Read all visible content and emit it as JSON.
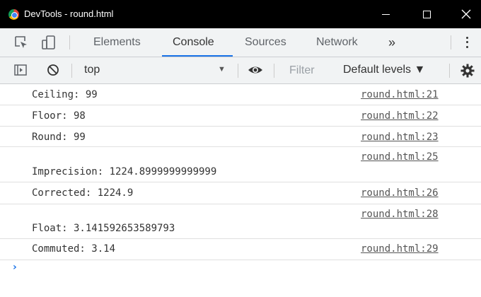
{
  "window": {
    "title": "DevTools - round.html",
    "icon": "chrome-icon"
  },
  "tabs": [
    {
      "label": "Elements",
      "active": false
    },
    {
      "label": "Console",
      "active": true
    },
    {
      "label": "Sources",
      "active": false
    },
    {
      "label": "Network",
      "active": false
    }
  ],
  "tabs_overflow": "»",
  "console_toolbar": {
    "context": "top",
    "filter_placeholder": "Filter",
    "levels": "Default levels ▼"
  },
  "messages": [
    {
      "text": "Ceiling: 99",
      "source": "round.html:21"
    },
    {
      "text": "Floor: 98",
      "source": "round.html:22"
    },
    {
      "text": "Round: 99",
      "source": "round.html:23"
    },
    {
      "text": "Imprecision: 1224.8999999999999",
      "source": "round.html:25"
    },
    {
      "text": "Corrected: 1224.9",
      "source": "round.html:26"
    },
    {
      "text": "Float: 3.141592653589793",
      "source": "round.html:28"
    },
    {
      "text": "Commuted: 3.14",
      "source": "round.html:29"
    }
  ],
  "prompt": "›",
  "colors": {
    "titlebar": "#000000",
    "toolbar": "#f1f3f4",
    "active_tab_underline": "#1a73e8"
  }
}
